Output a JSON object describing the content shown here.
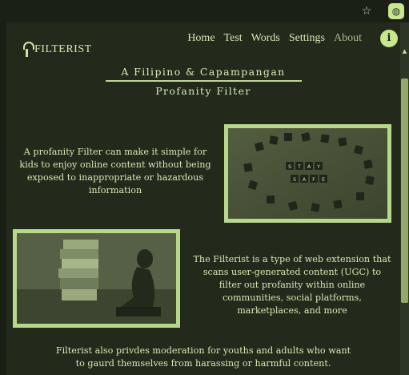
{
  "chrome": {
    "extensions_icon": "puzzle-icon",
    "profile_icon": "lightbulb-icon"
  },
  "logo": {
    "text": "FILTERIST"
  },
  "nav": {
    "items": [
      {
        "label": "Home"
      },
      {
        "label": "Test"
      },
      {
        "label": "Words"
      },
      {
        "label": "Settings"
      },
      {
        "label": "About"
      }
    ],
    "info_label": "i"
  },
  "hero": {
    "title_line1": "A Filipino & Capampangan",
    "title_line2": "Profanity Filter"
  },
  "section1": {
    "text": "A profanity Filter can make it simple for kids to enjoy online content without being exposed to inappropriate or hazardous information",
    "image_tiles": "STAY SAFE"
  },
  "section2": {
    "text": "The Filterist is a type of web extension that scans user-generated content (UGC) to filter out profanity within online communities, social platforms, marketplaces, and more"
  },
  "section3": {
    "text": "Filterist also privdes moderation for youths and adults who want to gaurd themselves from harassing or harmful content."
  },
  "colors": {
    "background": "#232a1c",
    "text": "#d4e7b3",
    "accent": "#c8e58f"
  }
}
